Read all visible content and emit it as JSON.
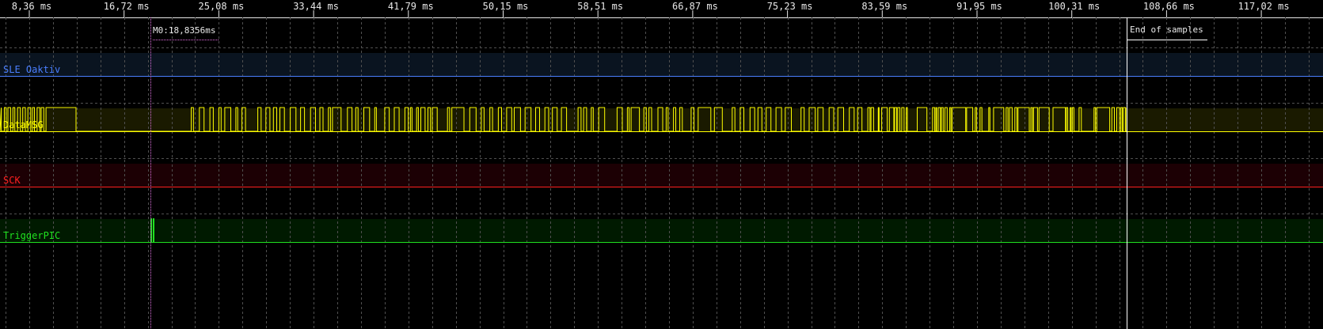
{
  "timeline": {
    "ticks": [
      "8,36 ms",
      "16,72 ms",
      "25,08 ms",
      "33,44 ms",
      "41,79 ms",
      "50,15 ms",
      "58,51 ms",
      "66,87 ms",
      "75,23 ms",
      "83,59 ms",
      "91,95 ms",
      "100,31 ms",
      "108,66 ms",
      "117,02 ms"
    ]
  },
  "marker": {
    "label": "M0:18,8356ms",
    "color": "#e070e0"
  },
  "end_of_samples": {
    "label": "End of samples"
  },
  "channels": [
    {
      "name": "SLE Oaktiv",
      "color": "#4a7fff",
      "bg": "#0a1420"
    },
    {
      "name": "DataMSG",
      "color": "#ffff00",
      "bg": "#1a1a00"
    },
    {
      "name": "SCK",
      "color": "#ff2020",
      "bg": "#1c0004"
    },
    {
      "name": "TriggerPIC",
      "color": "#20e020",
      "bg": "#001a00"
    }
  ],
  "colors": {
    "background": "#000000",
    "grid": "#505050",
    "axis": "#e8e8e8"
  }
}
